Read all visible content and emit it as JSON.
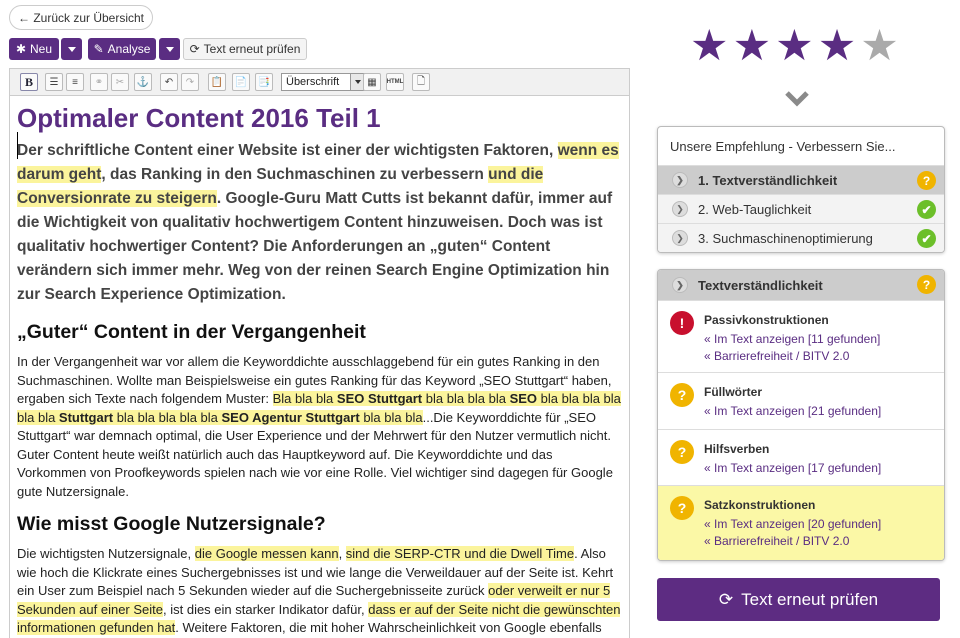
{
  "nav": {
    "back_label": "← Zurück zur Übersicht"
  },
  "toolbar": {
    "new_label": "Neu",
    "analyse_label": "Analyse",
    "recheck_label": "Text erneut prüfen"
  },
  "editor": {
    "format_value": "Überschrift",
    "html_label": "HTML",
    "bold_label": "B"
  },
  "article": {
    "title": "Optimaler Content 2016 Teil 1",
    "lead": {
      "a": "Der schriftliche Content einer Website ist einer der wichtigsten Faktoren, ",
      "b": "wenn es darum geht",
      "c": ", das Ranking in den Suchmaschinen zu verbessern ",
      "d": "und die Conversionrate zu steigern",
      "e": ". Google-Guru Matt Cutts ist bekannt dafür, immer auf die Wichtigkeit von qualitativ hochwertigem Content hinzuweisen. Doch was ist qualitativ hochwertiger Content? Die Anforderungen an „guten“ Content verändern sich immer mehr. Weg von der reinen Search Engine Optimization hin zur Search Experience Optimization."
    },
    "h2a": "„Guter“ Content in der Vergangenheit",
    "p1": {
      "a": "In der Vergangenheit war vor allem die Keyworddichte ausschlaggebend für ein gutes Ranking in den Suchmaschinen. Wollte man Beispielsweise ein gutes Ranking für das Keyword „SEO Stuttgart“ haben, ergaben sich Texte nach folgendem Muster: ",
      "b1": "Bla bla bla ",
      "b2": "SEO Stuttgart",
      "b3": " bla bla bla bla ",
      "b4": "SEO",
      "b5": " bla bla bla bla bla bla ",
      "b6": "Stuttgart",
      "b7": " bla bla bla bla bla ",
      "b8": "SEO Agentur Stuttgart",
      "b9": " bla bla bla",
      "c": "...Die Keyworddichte für „SEO Stuttgart“ war demnach optimal, die User Experience und der Mehrwert für den Nutzer vermutlich nicht. Guter Content heute weißt natürlich auch das Hauptkeyword auf. Die Keyworddichte und das Vorkommen von Proofkeywords spielen nach wie vor eine Rolle. Viel wichtiger sind dagegen für Google gute Nutzersignale."
    },
    "h2b": "Wie misst Google Nutzersignale?",
    "p2": {
      "a": "Die wichtigsten Nutzersignale, ",
      "b": "die Google messen kann",
      "c": ", ",
      "d": "sind die SERP-CTR und die Dwell Time",
      "e": ". Also wie hoch die Klickrate eines Suchergebnisses ist und wie lange die Verweildauer auf der Seite ist. Kehrt ein User zum Beispiel nach 5 Sekunden wieder auf die Suchergebnisseite zurück ",
      "f": "oder verweilt er nur 5 Sekunden auf einer Seite",
      "g": ", ist dies ein starker Indikator dafür, ",
      "h": "dass er auf der Seite nicht die gewünschten informationen gefunden hat",
      "i": ". Weitere Faktoren, die mit hoher Wahrscheinlichkeit von Google ebenfalls gemessen werden sind:"
    }
  },
  "rating": {
    "stars": 4,
    "max": 5,
    "color_on": "#5a2d82",
    "color_off": "#aaaaaa"
  },
  "recommend": {
    "title": "Unsere Empfehlung - Verbessern Sie...",
    "items": [
      {
        "label": "1. Textverständlichkeit",
        "status": "?"
      },
      {
        "label": "2. Web-Tauglichkeit",
        "status": "✔"
      },
      {
        "label": "3. Suchmaschinenoptimierung",
        "status": "✔"
      }
    ]
  },
  "details": {
    "title": "Textverständlichkeit",
    "status": "?",
    "issues": [
      {
        "title": "Passivkonstruktionen",
        "icon": "!",
        "links": [
          "« Im Text anzeigen [11 gefunden]",
          "« Barrierefreiheit / BITV 2.0"
        ]
      },
      {
        "title": "Füllwörter",
        "icon": "?",
        "links": [
          "« Im Text anzeigen [21 gefunden]"
        ]
      },
      {
        "title": "Hilfsverben",
        "icon": "?",
        "links": [
          "« Im Text anzeigen [17 gefunden]"
        ]
      },
      {
        "title": "Satzkonstruktionen",
        "icon": "?",
        "links": [
          "« Im Text anzeigen [20 gefunden]",
          "« Barrierefreiheit / BITV 2.0"
        ]
      }
    ]
  },
  "cta": {
    "label": "Text erneut prüfen"
  }
}
